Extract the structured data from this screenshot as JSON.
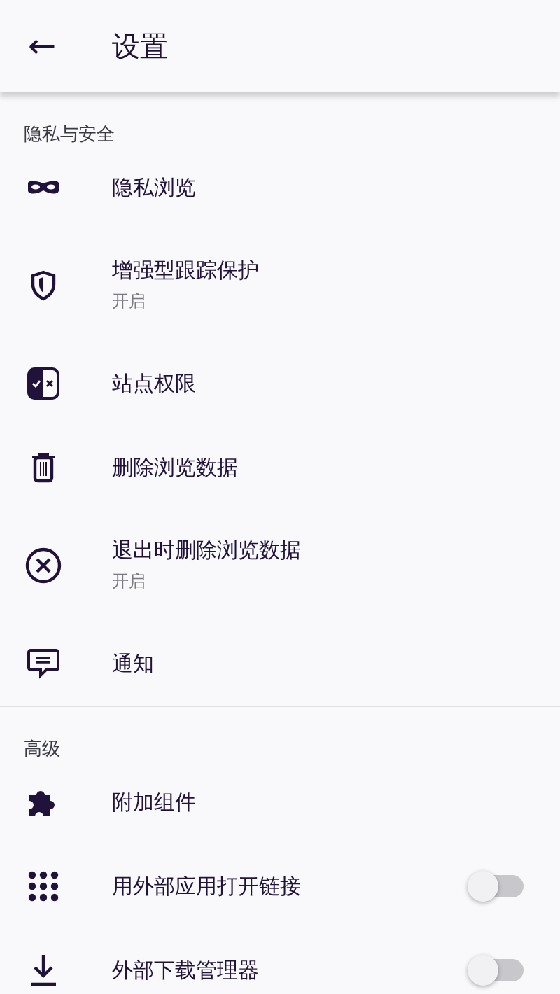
{
  "app_bar": {
    "back": "←",
    "title": "设置"
  },
  "sections": [
    {
      "title": "隐私与安全",
      "items": [
        {
          "kind": "nav",
          "label": "隐私浏览"
        },
        {
          "kind": "nav",
          "label": "增强型跟踪保护",
          "summary": "开启"
        },
        {
          "kind": "nav",
          "label": "站点权限"
        },
        {
          "kind": "nav",
          "label": "删除浏览数据"
        },
        {
          "kind": "nav",
          "label": "退出时删除浏览数据",
          "summary": "开启"
        },
        {
          "kind": "nav",
          "label": "通知"
        }
      ]
    },
    {
      "title": "高级",
      "items": [
        {
          "kind": "nav",
          "label": "附加组件"
        },
        {
          "kind": "toggle",
          "label": "用外部应用打开链接",
          "on": false
        },
        {
          "kind": "toggle",
          "label": "外部下载管理器",
          "on": false
        }
      ]
    }
  ]
}
